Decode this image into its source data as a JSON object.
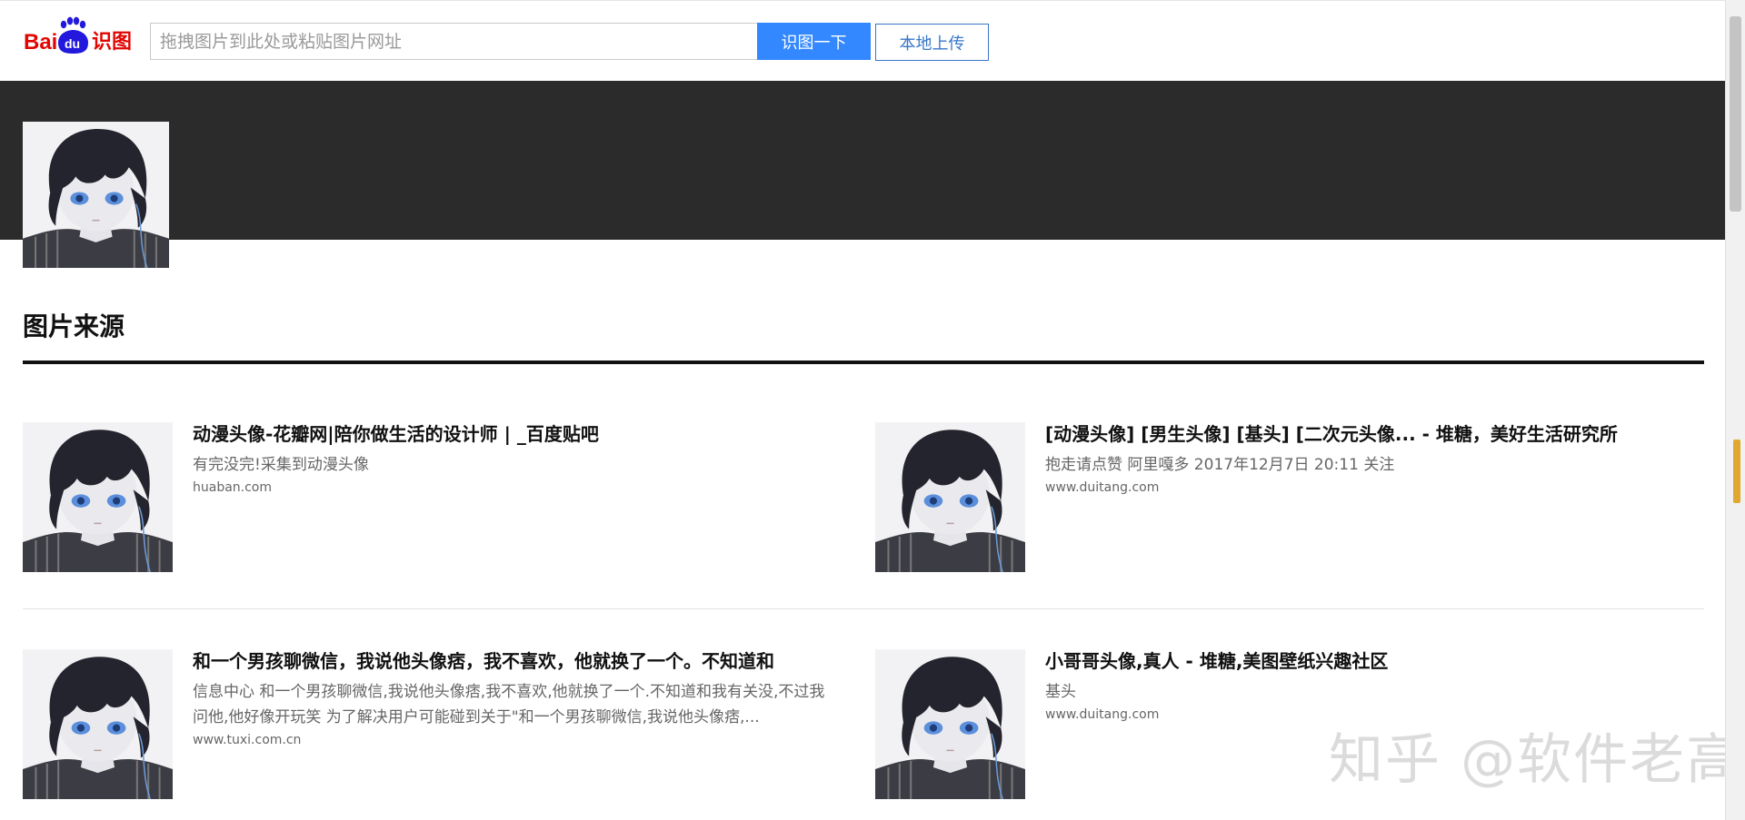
{
  "logo": {
    "brand_left": "Bai",
    "brand_paw": "du",
    "brand_right": "识图"
  },
  "search": {
    "placeholder": "拖拽图片到此处或粘贴图片网址",
    "value": "",
    "search_button": "识图一下",
    "upload_button": "本地上传"
  },
  "section": {
    "title": "图片来源"
  },
  "results": [
    {
      "title": "动漫头像-花瓣网|陪你做生活的设计师 | _百度贴吧",
      "desc": "有完没完!采集到动漫头像",
      "url": "huaban.com"
    },
    {
      "title": "[动漫头像] [男生头像] [基头] [二次元头像... - 堆糖，美好生活研究所",
      "desc": "抱走请点赞 阿里嘎多 2017年12月7日 20:11 关注",
      "url": "www.duitang.com"
    },
    {
      "title": "和一个男孩聊微信，我说他头像痞，我不喜欢，他就换了一个。不知道和",
      "desc": "信息中心 和一个男孩聊微信,我说他头像痞,我不喜欢,他就换了一个.不知道和我有关没,不过我问他,他好像开玩笑 为了解决用户可能碰到关于\"和一个男孩聊微信,我说他头像痞,...",
      "url": "www.tuxi.com.cn"
    },
    {
      "title": "小哥哥头像,真人 - 堆糖,美图壁纸兴趣社区",
      "desc": "基头",
      "url": "www.duitang.com"
    }
  ],
  "watermark": "知乎 @软件老高",
  "colors": {
    "primary": "#3388ff",
    "upload_border": "#3877c9",
    "banner": "#2b2b2b",
    "logo_red": "#e10602",
    "logo_blue": "#2319dc"
  }
}
